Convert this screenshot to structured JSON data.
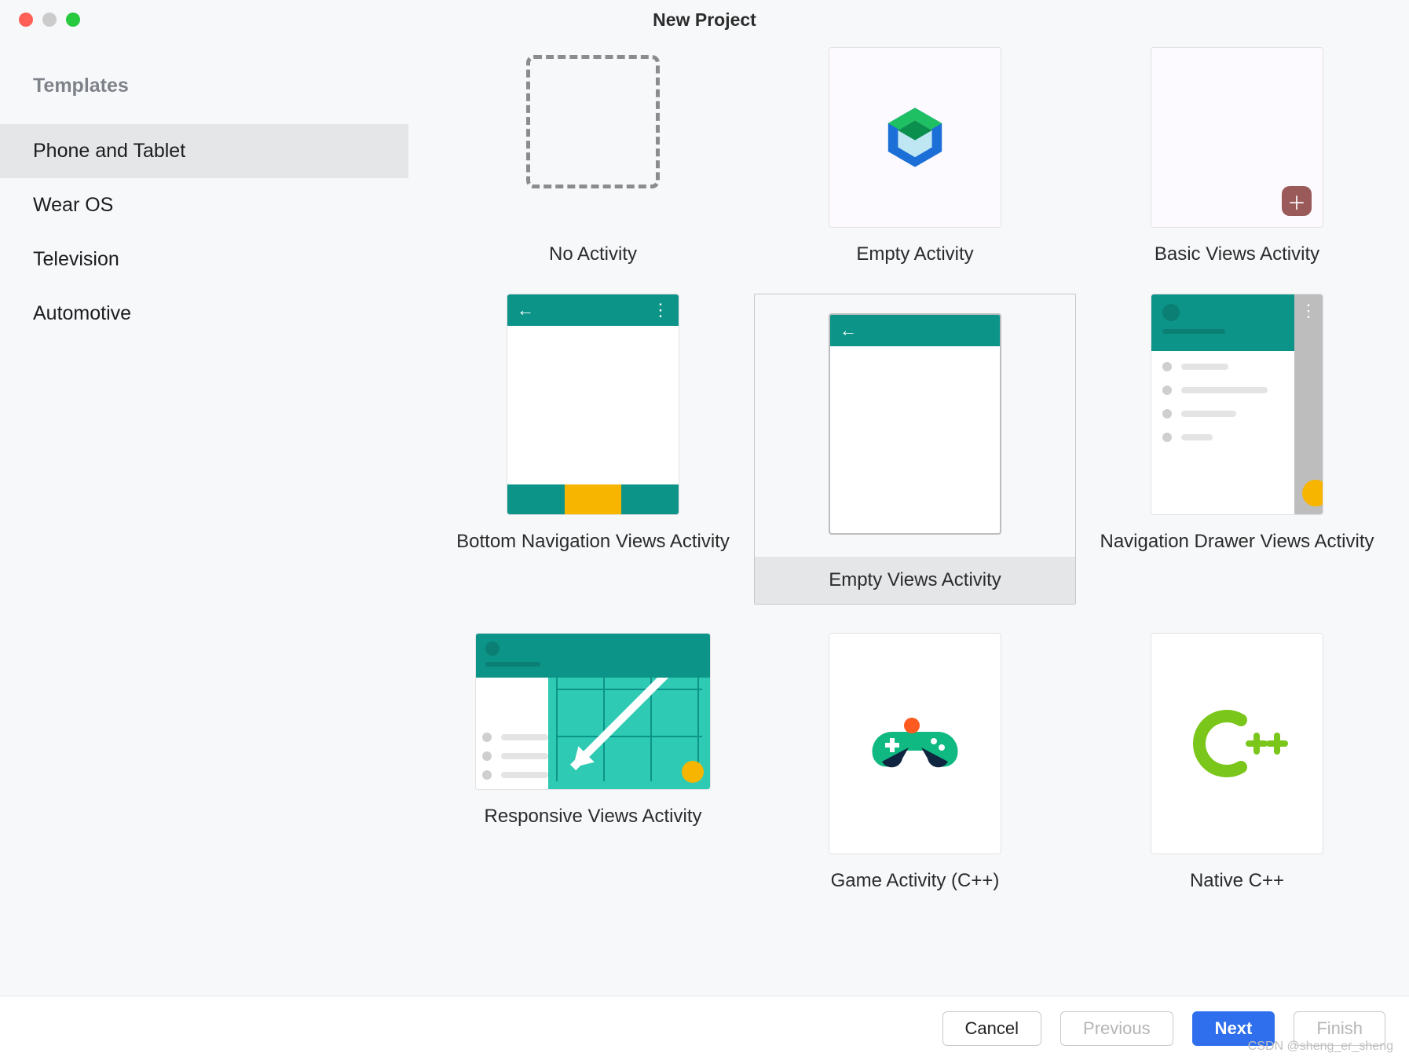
{
  "window": {
    "title": "New Project"
  },
  "sidebar": {
    "heading": "Templates",
    "items": [
      {
        "label": "Phone and Tablet",
        "selected": true
      },
      {
        "label": "Wear OS",
        "selected": false
      },
      {
        "label": "Television",
        "selected": false
      },
      {
        "label": "Automotive",
        "selected": false
      }
    ]
  },
  "templates": [
    {
      "label": "No Activity",
      "kind": "no-activity",
      "selected": false
    },
    {
      "label": "Empty Activity",
      "kind": "compose",
      "selected": false
    },
    {
      "label": "Basic Views Activity",
      "kind": "basic-plus",
      "selected": false
    },
    {
      "label": "Bottom Navigation Views Activity",
      "kind": "bottom-nav",
      "selected": false
    },
    {
      "label": "Empty Views Activity",
      "kind": "empty-views",
      "selected": true
    },
    {
      "label": "Navigation Drawer Views Activity",
      "kind": "nav-drawer",
      "selected": false
    },
    {
      "label": "Responsive Views Activity",
      "kind": "responsive",
      "selected": false
    },
    {
      "label": "Game Activity (C++)",
      "kind": "game",
      "selected": false
    },
    {
      "label": "Native C++",
      "kind": "native-cpp",
      "selected": false
    }
  ],
  "footer": {
    "cancel": "Cancel",
    "previous": "Previous",
    "next": "Next",
    "finish": "Finish"
  },
  "watermark": "CSDN @sheng_er_sheng"
}
